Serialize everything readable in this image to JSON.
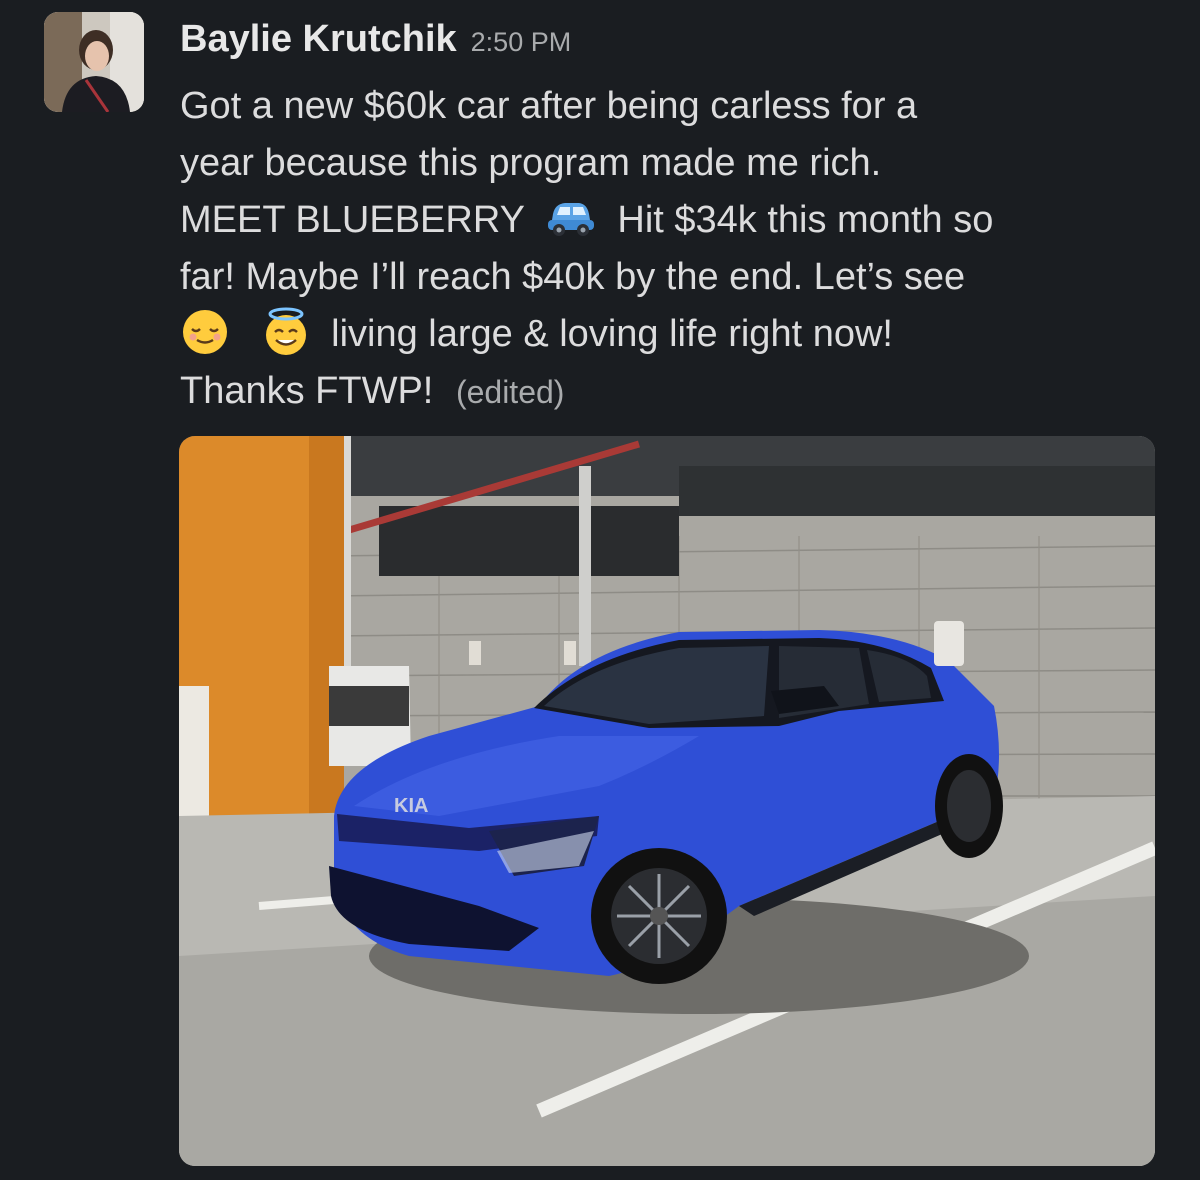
{
  "message": {
    "author": "Baylie Krutchik",
    "timestamp": "2:50 PM",
    "lines": [
      {
        "text": "Got a new $60k car after being carless for a"
      },
      {
        "text": "year because this program made me rich."
      },
      {
        "before": "MEET BLUEBERRY",
        "emoji": "blue-car-emoji",
        "after": "Hit $34k this month so"
      },
      {
        "text": "far! Maybe I’ll reach $40k by the end. Let’s see"
      },
      {
        "emoji_1": "relieved-face-emoji",
        "emoji_2": "smiling-face-with-halo-emoji",
        "after": "living large & loving life right now!"
      },
      {
        "text": "Thanks FTWP!"
      }
    ],
    "edited_label": "(edited)",
    "attachment": {
      "type": "image",
      "subject": "blue car parked in garage",
      "badge_text": "KIA"
    }
  },
  "colors": {
    "background": "#1a1d21",
    "author": "#e8e8e8",
    "body_text": "#dcdcdd",
    "meta_text": "#a9abad",
    "car_blue": "#2f4fd6"
  }
}
